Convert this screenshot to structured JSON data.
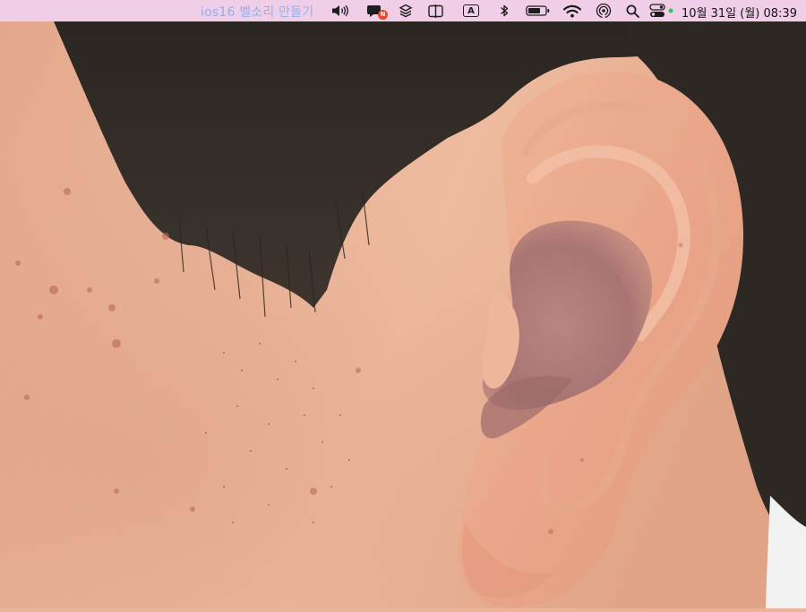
{
  "menubar": {
    "app_title": "ios16 벨소리 만들기",
    "clock": "10월 31일 (월) 08:39",
    "translate_badge": "N",
    "input_source": "A",
    "status_dot_color": "#33c759",
    "icons": [
      "volume-icon",
      "translate-icon",
      "layers-icon",
      "split-view-icon",
      "input-source-icon",
      "bluetooth-icon",
      "battery-icon",
      "wifi-icon",
      "airdrop-icon",
      "search-icon",
      "control-center-icon"
    ]
  },
  "photo": {
    "subject": "close-up side view of a man's ear and cheek with short dark hair"
  }
}
